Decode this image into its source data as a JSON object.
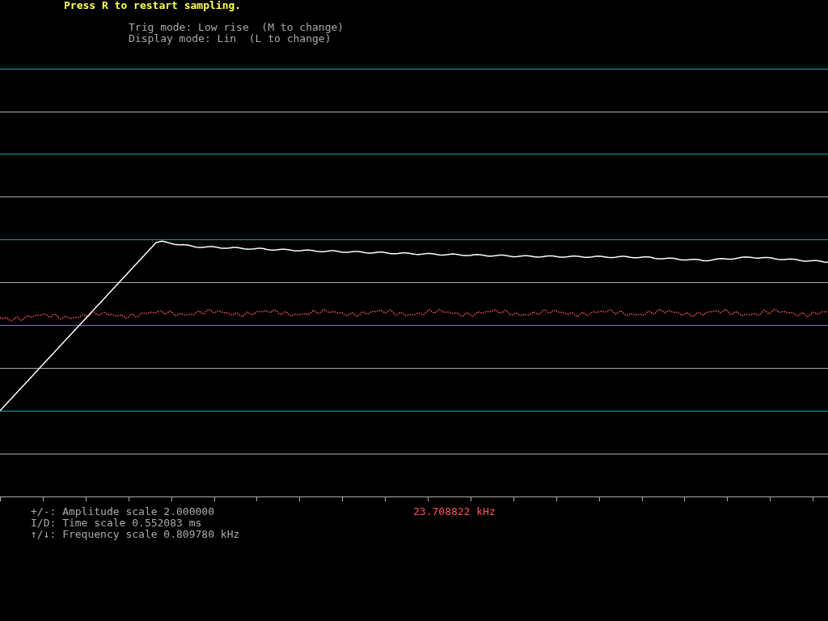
{
  "prompt": "Press R to restart sampling.",
  "modes": [
    "Trig mode: Low rise  (M to change)",
    "Display mode: Lin  (L to change)"
  ],
  "scales": [
    "+/-: Amplitude scale 2.000000",
    "I/D: Time scale 0.552083 ms",
    "↑/↓: Frequency scale 0.809780 kHz"
  ],
  "frequency": "23.708822 kHz"
}
